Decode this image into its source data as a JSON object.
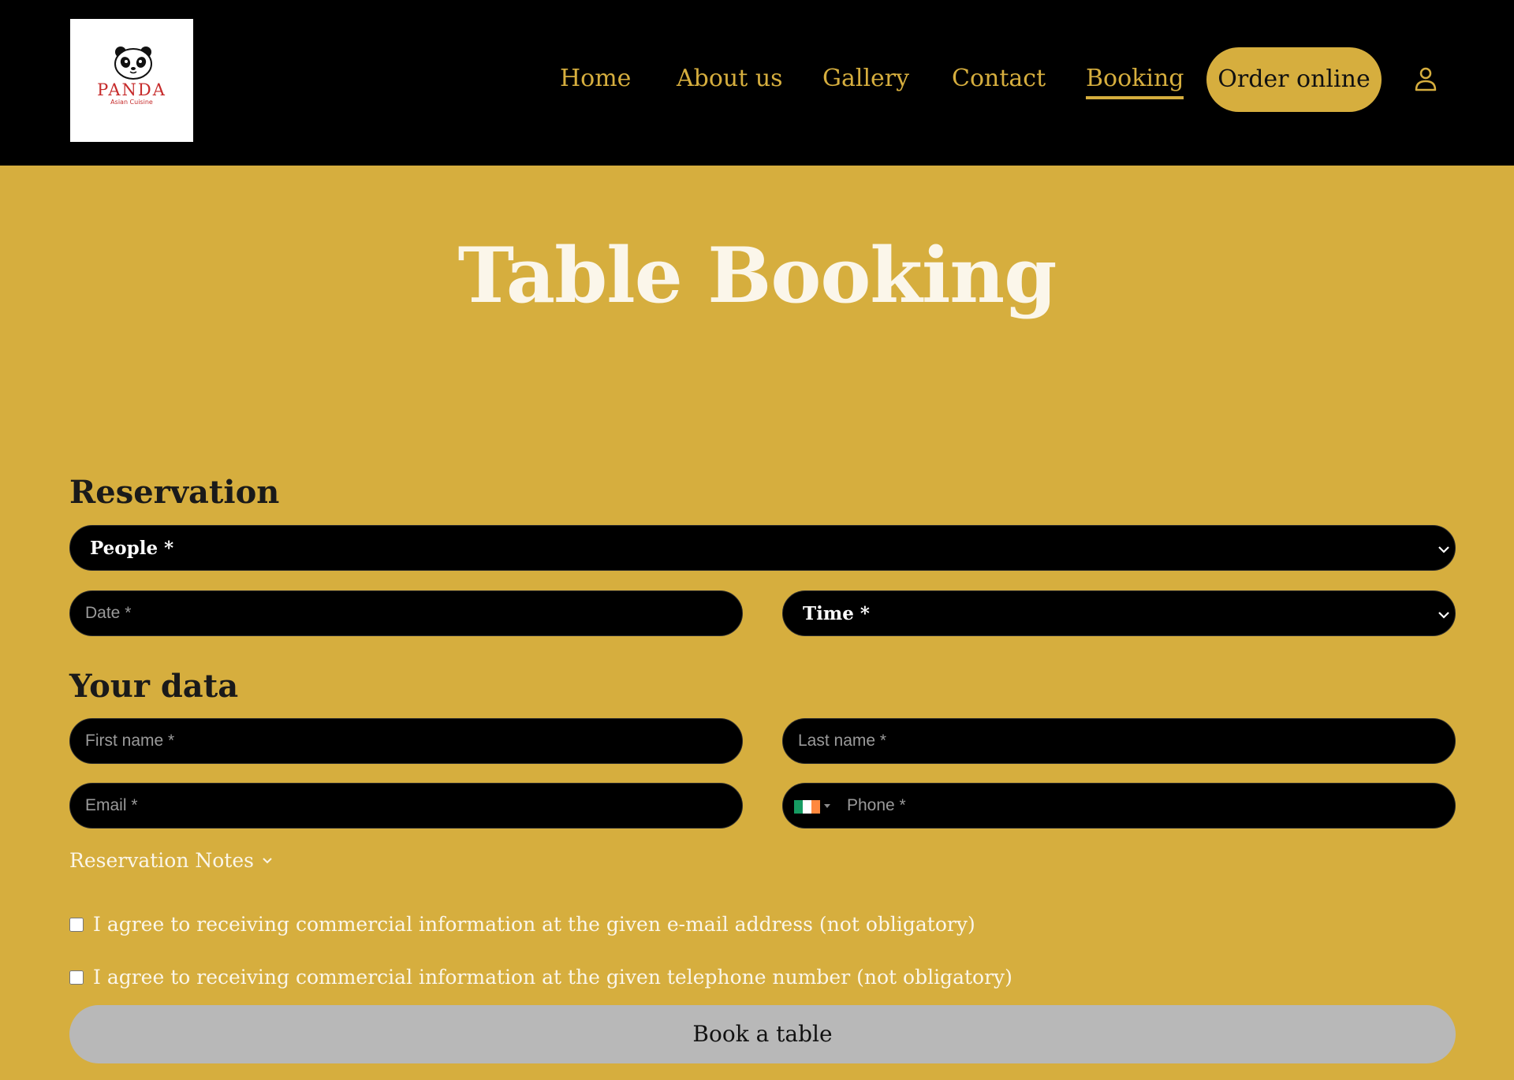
{
  "brand": {
    "logo_name": "PANDA",
    "logo_tagline": "Asian Cuisine"
  },
  "nav": {
    "items": [
      {
        "label": "Home"
      },
      {
        "label": "About us"
      },
      {
        "label": "Gallery"
      },
      {
        "label": "Contact"
      },
      {
        "label": "Booking",
        "active": true
      }
    ],
    "order_button": "Order online",
    "account_icon": "user-icon"
  },
  "page": {
    "title": "Table Booking"
  },
  "reservation": {
    "section_title": "Reservation",
    "people_label": "People *",
    "date_placeholder": "Date *",
    "time_label": "Time *"
  },
  "your_data": {
    "section_title": "Your data",
    "first_name_placeholder": "First name *",
    "last_name_placeholder": "Last name *",
    "email_placeholder": "Email *",
    "phone_placeholder": "Phone *",
    "phone_country_flag": "ireland-flag-icon"
  },
  "notes": {
    "label": "Reservation Notes"
  },
  "consents": [
    {
      "label": "I agree to receiving commercial information at the given e-mail address (not obligatory)",
      "checked": false
    },
    {
      "label": "I agree to receiving commercial information at the given telephone number (not obligatory)",
      "checked": false
    }
  ],
  "submit": {
    "label": "Book a table"
  },
  "colors": {
    "background": "#d6ae3e",
    "header": "#000000",
    "accent": "#d6ae3e",
    "field": "#000000",
    "button_disabled": "#b8b8b8",
    "logo_red": "#c62b2b"
  }
}
